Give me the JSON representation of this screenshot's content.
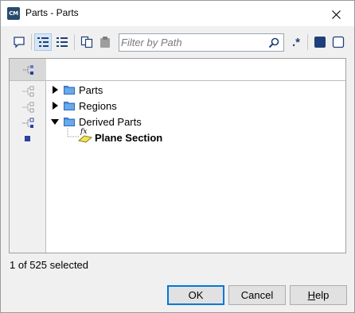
{
  "window": {
    "title": "Parts - Parts",
    "app_icon_text": "CM"
  },
  "toolbar": {
    "filter_placeholder": "Filter by Path",
    "regex_label": ".*"
  },
  "tree": {
    "items": [
      {
        "label": "Parts",
        "expanded": false,
        "icon": "folder-icon"
      },
      {
        "label": "Regions",
        "expanded": false,
        "icon": "folder-icon"
      },
      {
        "label": "Derived Parts",
        "expanded": true,
        "icon": "folder-icon"
      },
      {
        "label": "Plane Section",
        "icon": "plane-section-icon",
        "selected": true,
        "child_of": "Derived Parts",
        "marker": "fx"
      }
    ]
  },
  "status": {
    "text": "1 of 525 selected"
  },
  "buttons": {
    "ok_label": "OK",
    "cancel_label": "Cancel",
    "help_label": "Help"
  },
  "colors": {
    "accent": "#0078d7",
    "folder": "#4a8fd8",
    "selected_marker": "#2c3fa3"
  }
}
